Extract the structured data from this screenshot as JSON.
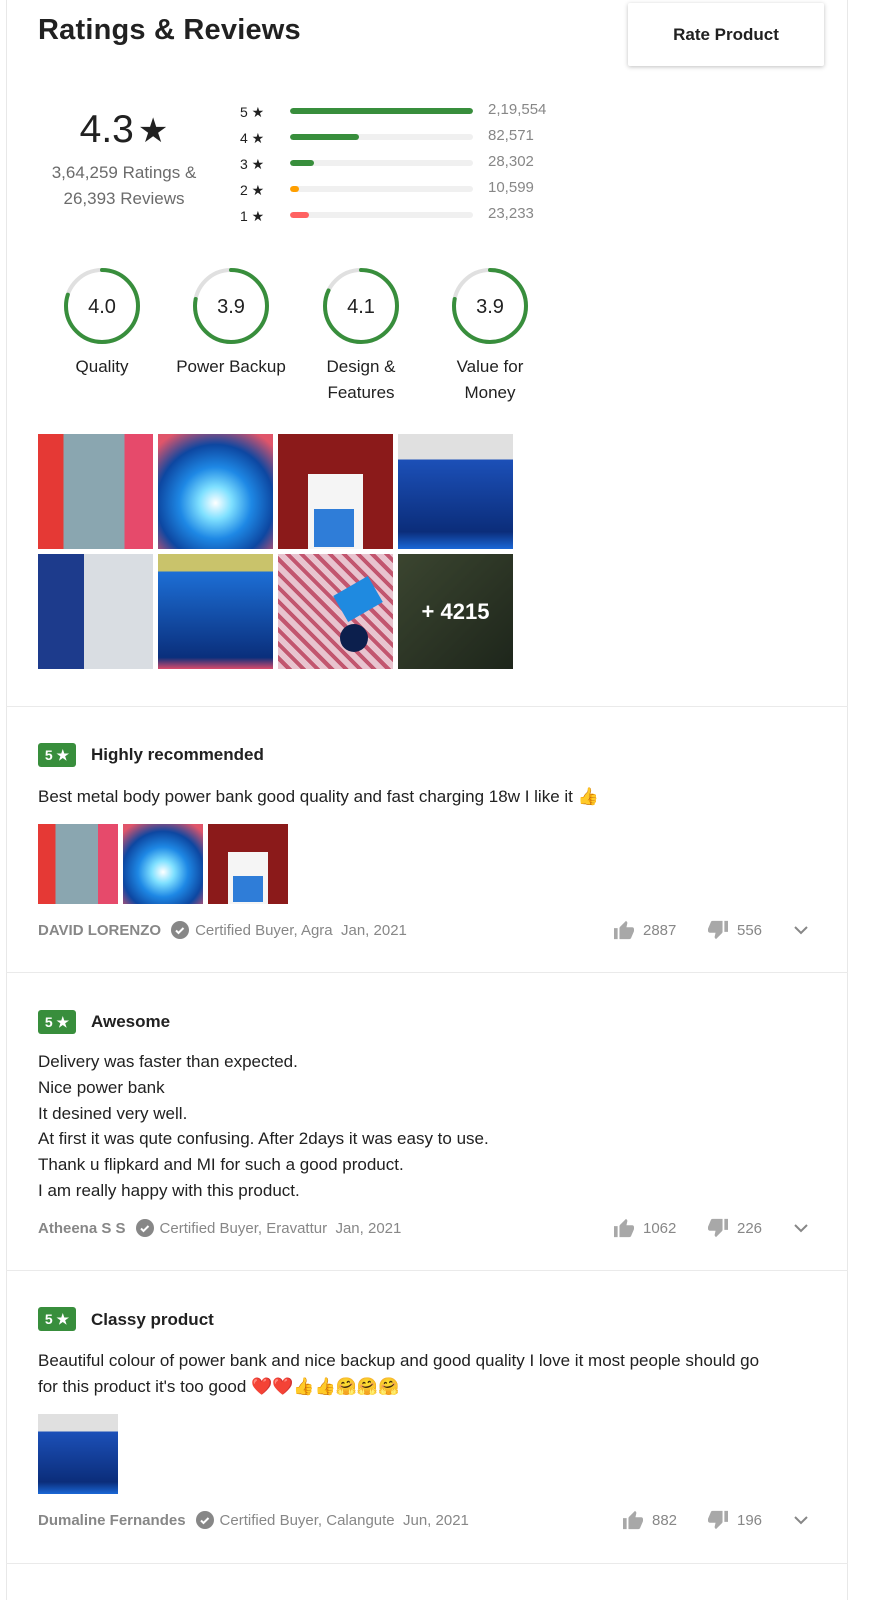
{
  "header": {
    "title": "Ratings & Reviews",
    "rate_button": "Rate Product"
  },
  "summary": {
    "average": "4.3",
    "star": "★",
    "ratings_line": "3,64,259 Ratings &",
    "reviews_line": "26,393 Reviews"
  },
  "distribution": [
    {
      "label": "5 ★",
      "count": "2,19,554",
      "fraction": 1.0,
      "color": "#388e3c"
    },
    {
      "label": "4 ★",
      "count": "82,571",
      "fraction": 0.376,
      "color": "#388e3c"
    },
    {
      "label": "3 ★",
      "count": "28,302",
      "fraction": 0.129,
      "color": "#388e3c"
    },
    {
      "label": "2 ★",
      "count": "10,599",
      "fraction": 0.048,
      "color": "#ff9f00"
    },
    {
      "label": "1 ★",
      "count": "23,233",
      "fraction": 0.106,
      "color": "#ff6161"
    }
  ],
  "aspects": [
    {
      "score": "4.0",
      "label": "Quality",
      "fraction": 0.8
    },
    {
      "score": "3.9",
      "label": "Power Backup",
      "fraction": 0.78
    },
    {
      "score": "4.1",
      "label": "Design & Features",
      "fraction": 0.82
    },
    {
      "score": "3.9",
      "label": "Value for Money",
      "fraction": 0.78
    }
  ],
  "gallery": {
    "more_label": "+ 4215"
  },
  "reviews": [
    {
      "rating": "5 ★",
      "title": "Highly recommended",
      "text": [
        "Best metal body power bank good quality and fast charging 18w I like it 👍"
      ],
      "author": "DAVID LORENZO",
      "buyer": "Certified Buyer, Agra",
      "date": "Jan, 2021",
      "likes": "2887",
      "dislikes": "556"
    },
    {
      "rating": "5 ★",
      "title": "Awesome",
      "text": [
        "Delivery was faster than expected.",
        "Nice power bank",
        "It desined very well.",
        "At first it was qute confusing. After 2days it was easy to use.",
        "Thank u flipkard and MI for such a good product.",
        "I am really happy with this product."
      ],
      "author": "Atheena S S",
      "buyer": "Certified Buyer, Eravattur",
      "date": "Jan, 2021",
      "likes": "1062",
      "dislikes": "226"
    },
    {
      "rating": "5 ★",
      "title": "Classy product",
      "text": [
        "Beautiful colour of power bank and nice backup and good quality I love it most people should go",
        "for this product it's too good ❤️❤️👍👍🤗🤗🤗"
      ],
      "author": "Dumaline Fernandes",
      "buyer": "Certified Buyer, Calangute",
      "date": "Jun, 2021",
      "likes": "882",
      "dislikes": "196"
    }
  ],
  "colors": {
    "accent": "#388e3c",
    "muted": "#878787"
  }
}
